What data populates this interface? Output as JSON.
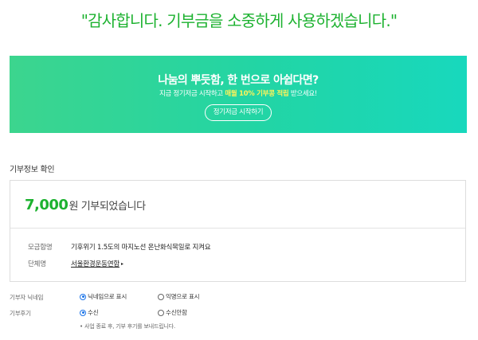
{
  "thanks_message": "\"감사합니다. 기부금을 소중하게 사용하겠습니다.\"",
  "banner": {
    "title": "나눔의 뿌듯함, 한 번으로 아쉽다면?",
    "subtitle_before": "지금 정기저금 시작하고",
    "subtitle_highlight": "매월 10% 기부콩 적립",
    "subtitle_after": "받으세요!",
    "button_label": "정기저금 시작하기",
    "gradient_colors": [
      "#3cd58e",
      "#18d8bd"
    ],
    "highlight_color": "#fff25a"
  },
  "section_title": "기부정보 확인",
  "donation": {
    "amount": "7,000",
    "unit_text": "원 기부되었습니다",
    "accent_color": "#1db230",
    "campaign_label": "모금함명",
    "campaign_value": "기후위기 1.5도의 마지노선 온난화식목일로 지켜요",
    "org_label": "단체명",
    "org_value": "서울환경운동연합",
    "org_caret": "▸"
  },
  "options": {
    "nickname": {
      "label": "기부자 닉네임",
      "choices": [
        "닉네임으로 표시",
        "익명으로 표시"
      ],
      "selected": "닉네임으로 표시"
    },
    "review": {
      "label": "기부후기",
      "choices": [
        "수신",
        "수신안함"
      ],
      "selected": "수신"
    },
    "note": "• 사업 종료 후, 기부 후기를 보내드립니다."
  }
}
